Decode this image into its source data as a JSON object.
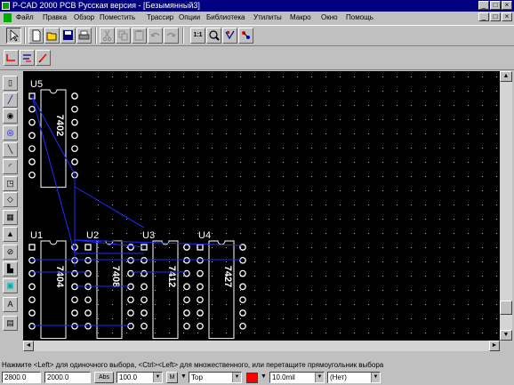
{
  "window": {
    "title": "P-CAD 2000 PCB Русская версия - [Безымянный3]",
    "minimize": "_",
    "maximize": "□",
    "close": "×"
  },
  "menu": [
    "Файл",
    "Правка",
    "Обзор",
    "Поместить",
    "Трассир",
    "Опции",
    "Библиотека",
    "Утилиты",
    "Макро",
    "Окно",
    "Помощь"
  ],
  "toolbar": {
    "zoom_label": "1:1",
    "buttons": [
      "select-icon",
      "new-file-icon",
      "open-file-icon",
      "save-icon",
      "print-icon",
      "cut-icon",
      "copy-icon",
      "paste-icon",
      "undo-icon",
      "redo-icon",
      "zoom-window-icon",
      "zoom-icon",
      "design-check-icon",
      "netlist-icon"
    ]
  },
  "toolbar2": [
    "route-icon",
    "net-icon",
    "cleanup-icon"
  ],
  "left_tools": [
    "component-icon",
    "connection-icon",
    "pad-icon",
    "via-icon",
    "line-icon",
    "arc-icon",
    "text-icon",
    "polygon-icon",
    "fill-icon",
    "copper-icon",
    "keepout-icon",
    "cutout-icon",
    "plane-icon",
    "attribute-icon",
    "field-icon"
  ],
  "components": [
    {
      "ref": "U5",
      "type": "7402"
    },
    {
      "ref": "U1",
      "type": "7404"
    },
    {
      "ref": "U2",
      "type": "7408"
    },
    {
      "ref": "U3",
      "type": "7412"
    },
    {
      "ref": "U4",
      "type": "7427"
    }
  ],
  "status": {
    "hint": "Нажмите <Left> для одиночного выбора, <Ctrl><Left> для множественного, или перетащите прямоугольник выбора"
  },
  "bottom": {
    "x": "2800.0",
    "y": "2000.0",
    "abs_label": "Abs",
    "grid": "100.0",
    "m_label": "M",
    "layer": "Top",
    "layer_color": "#ff0000",
    "line_width": "10.0mil",
    "net": "(Нет)"
  },
  "colors": {
    "canvas": "#000000",
    "grid_dot": "#c0c0c0",
    "outline": "#ffffff",
    "pad": "#ffffff",
    "ratsnest": "#1f2bff"
  }
}
